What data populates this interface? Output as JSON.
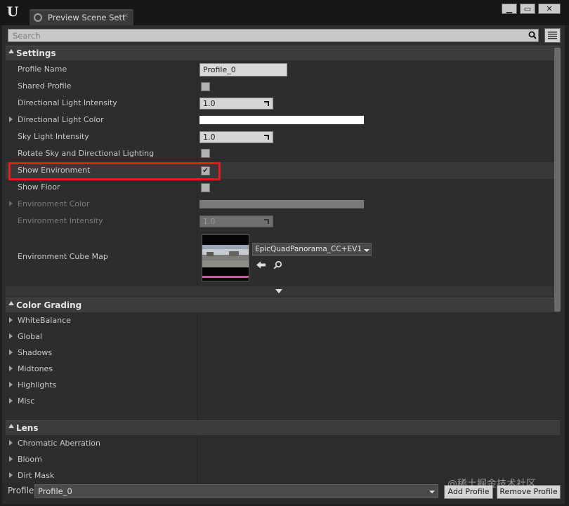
{
  "window": {
    "tab_title": "Preview Scene Sett",
    "logo": "U",
    "minimize_glyph": "▁",
    "maximize_glyph": "▭",
    "close_glyph": "✕",
    "tab_close_glyph": "×"
  },
  "search": {
    "placeholder": "Search"
  },
  "settings": {
    "header": "Settings",
    "rows": {
      "profile_name": {
        "label": "Profile Name",
        "value": "Profile_0"
      },
      "shared_profile": {
        "label": "Shared Profile",
        "checked": false
      },
      "dir_light_intensity": {
        "label": "Directional Light Intensity",
        "value": "1.0"
      },
      "dir_light_color": {
        "label": "Directional Light Color",
        "color": "#ffffff"
      },
      "sky_light_intensity": {
        "label": "Sky Light Intensity",
        "value": "1.0"
      },
      "rotate_sky": {
        "label": "Rotate Sky and Directional Lighting",
        "checked": false
      },
      "show_environment": {
        "label": "Show Environment",
        "checked": true,
        "check_glyph": "✔"
      },
      "show_floor": {
        "label": "Show Floor",
        "checked": false
      },
      "environment_color": {
        "label": "Environment Color",
        "color": "#7a7a7a"
      },
      "environment_intensity": {
        "label": "Environment Intensity",
        "value": "1.0"
      },
      "environment_cube_map": {
        "label": "Environment Cube Map",
        "asset": "EpicQuadPanorama_CC+EV1"
      }
    }
  },
  "color_grading": {
    "header": "Color Grading",
    "items": [
      "WhiteBalance",
      "Global",
      "Shadows",
      "Midtones",
      "Highlights",
      "Misc"
    ]
  },
  "lens": {
    "header": "Lens",
    "items": [
      "Chromatic Aberration",
      "Bloom",
      "Dirt Mask"
    ]
  },
  "footer": {
    "profile_label": "Profile",
    "profile_value": "Profile_0",
    "add_button": "Add Profile",
    "remove_button": "Remove Profile"
  },
  "watermark": "@稀土掘金技术社区",
  "colors": {
    "highlight": "#e21b1b"
  }
}
